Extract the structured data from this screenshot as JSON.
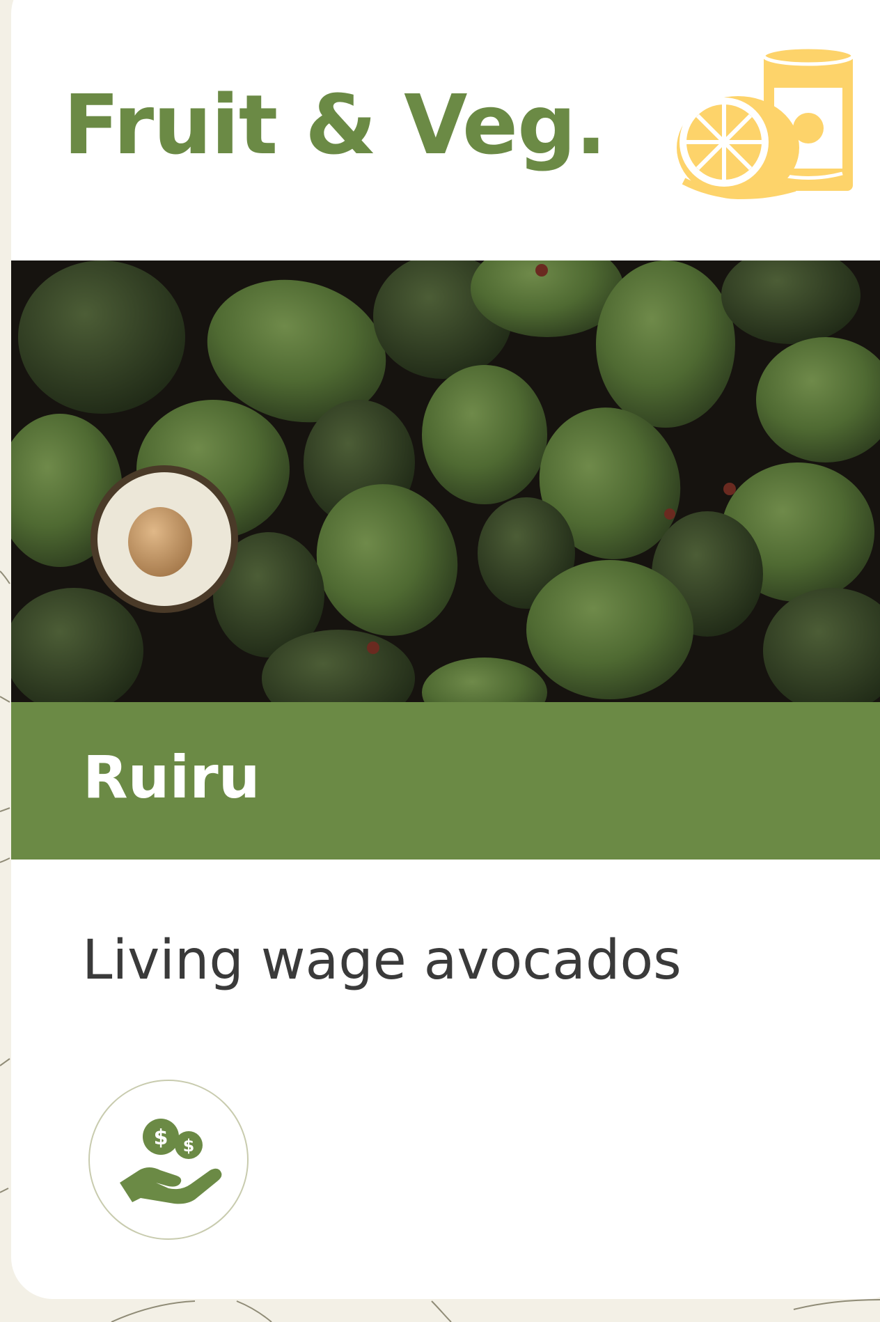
{
  "card": {
    "category_title": "Fruit & Veg.",
    "category_icon": "fruit-and-can-icon",
    "photo_subject": "avocados",
    "location_name": "Ruiru",
    "product_description": "Living wage avocados",
    "badge_icon": "hand-with-coins-icon"
  },
  "colors": {
    "brand_green": "#6b8a45",
    "icon_yellow": "#fdd36a",
    "page_background": "#f3f0e6",
    "text_dark": "#3a3a3a"
  }
}
